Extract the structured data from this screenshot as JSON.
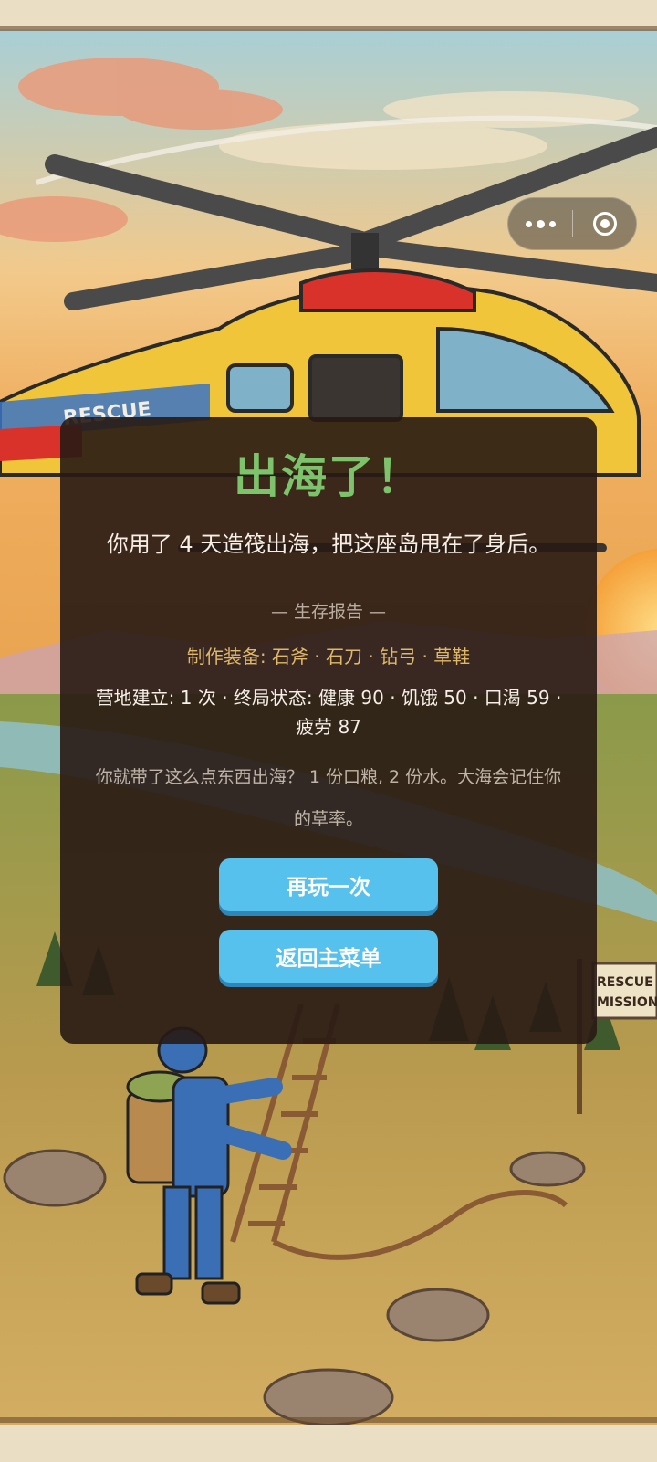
{
  "capsule": {
    "more_icon": "more-dots-icon",
    "close_icon": "close-target-icon"
  },
  "background": {
    "helicopter_text": "RESCUE",
    "sign_text_1": "RESCUE",
    "sign_text_2": "MISSION"
  },
  "result": {
    "title": "出海了！",
    "subtitle": "你用了 4 天造筏出海，把这座岛甩在了身后。",
    "report_header": "— 生存报告 —",
    "equipment": "制作装备: 石斧 · 石刀 · 钻弓 · 草鞋",
    "stats": "营地建立: 1 次 · 终局状态: 健康 90 · 饥饿 50 · 口渴 59 · 疲劳 87",
    "flavor": "你就带了这么点东西出海？ 1 份口粮, 2 份水。大海会记住你的草率。",
    "play_again_label": "再玩一次",
    "main_menu_label": "返回主菜单"
  },
  "colors": {
    "title_green": "#7cc36b",
    "equipment_gold": "#e0b869",
    "button_blue": "#57c1ee",
    "panel_dark": "#281a14"
  }
}
